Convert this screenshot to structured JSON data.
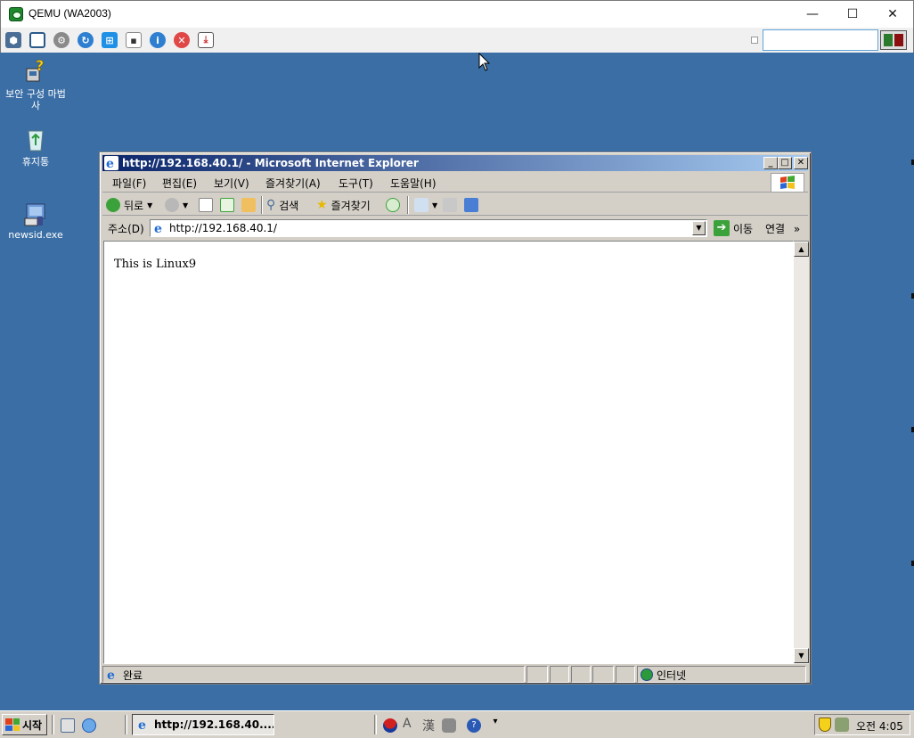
{
  "host": {
    "title": "QEMU (WA2003)",
    "controls": {
      "minimize": "—",
      "maximize": "☐",
      "close": "✕"
    },
    "toolbar_icons": [
      "settings-cubes-icon",
      "fullscreen-icon",
      "gear-icon",
      "refresh-icon",
      "windows-icon",
      "shell-icon",
      "info-icon",
      "stop-icon",
      "screenshot-icon"
    ]
  },
  "desktop": {
    "icons": [
      {
        "label": "보안 구성 마법사"
      },
      {
        "label": "휴지통"
      },
      {
        "label": "newsid.exe"
      }
    ]
  },
  "ie": {
    "title": "http://192.168.40.1/ - Microsoft Internet Explorer",
    "menu": [
      "파일(F)",
      "편집(E)",
      "보기(V)",
      "즐겨찾기(A)",
      "도구(T)",
      "도움말(H)"
    ],
    "toolbar": {
      "back_label": "뒤로",
      "search_label": "검색",
      "favorites_label": "즐겨찾기"
    },
    "address": {
      "label": "주소(D)",
      "value": "http://192.168.40.1/",
      "go_label": "이동",
      "links_label": "연결",
      "links_chevron": "»"
    },
    "page": {
      "text": "This is Linux9"
    },
    "status": {
      "text": "완료",
      "zone": "인터넷"
    }
  },
  "taskbar": {
    "start_label": "시작",
    "task_label": "http://192.168.40....",
    "ime": {
      "a": "A",
      "han": "漢"
    },
    "clock": "오전 4:05"
  }
}
